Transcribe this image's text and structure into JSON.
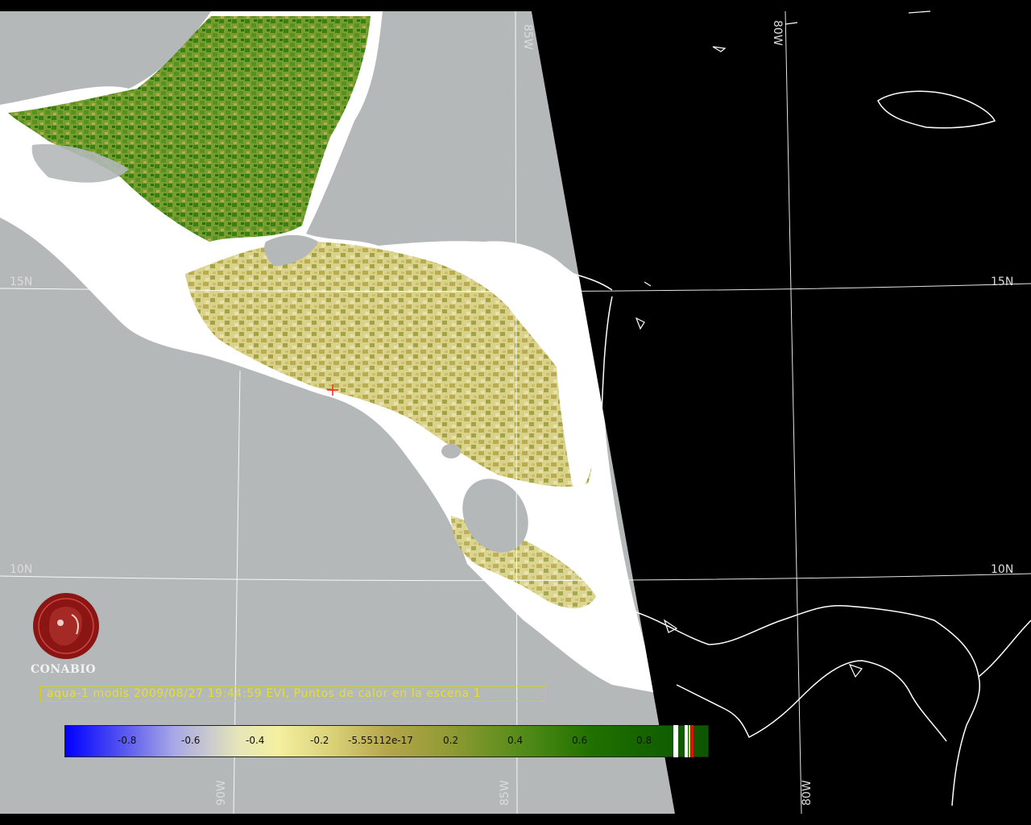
{
  "graticule": {
    "lat_labels": [
      "15N",
      "10N"
    ],
    "lon_labels": [
      "85W",
      "80W",
      "90W"
    ]
  },
  "logo": {
    "text": "CONABIO",
    "color": "#8b1512"
  },
  "caption": "aqua-1 modis 2009/08/27 19:44:59 EVI, Puntos de calor en la escena 1",
  "colorbar": {
    "ticks": [
      "-0.8",
      "-0.6",
      "-0.4",
      "-0.2",
      "-5.55112e-17",
      "0.2",
      "0.4",
      "0.6",
      "0.8"
    ],
    "range": [
      -1,
      1
    ],
    "colors": {
      "min": "#0000ff",
      "mid_negative": "#a8a8e6",
      "near_zero": "#f4f0a0",
      "positive_low": "#b5a64c",
      "max": "#0e5600"
    }
  },
  "colors": {
    "ocean_in_swath": "#b4b8b9",
    "outside_swath": "#000000",
    "cloud": "#ffffff",
    "graticule": "#ffffff",
    "hotspot": "#ff2020"
  }
}
